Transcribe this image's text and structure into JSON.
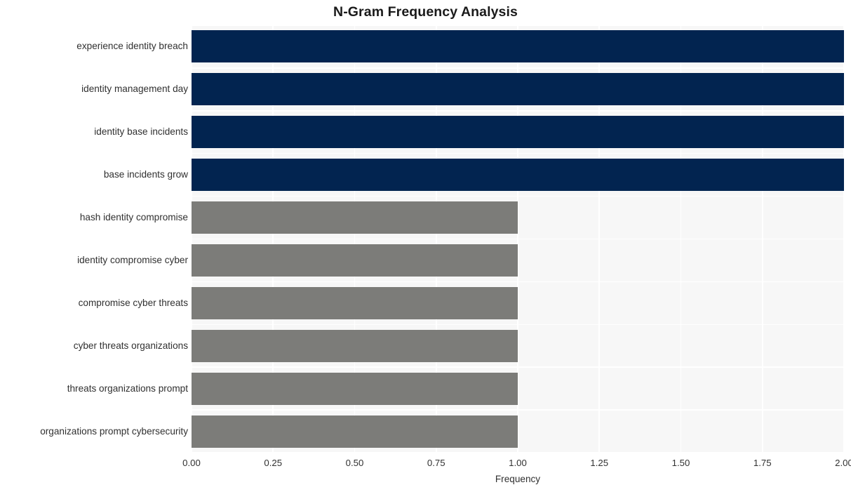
{
  "chart_data": {
    "type": "bar",
    "orientation": "horizontal",
    "title": "N-Gram Frequency Analysis",
    "xlabel": "Frequency",
    "ylabel": "",
    "xlim": [
      0,
      2
    ],
    "ylim": null,
    "grid": true,
    "legend": null,
    "xticklabels": [
      "0.00",
      "0.25",
      "0.50",
      "0.75",
      "1.00",
      "1.25",
      "1.50",
      "1.75",
      "2.00"
    ],
    "xticks": [
      0,
      0.25,
      0.5,
      0.75,
      1.0,
      1.25,
      1.5,
      1.75,
      2.0
    ],
    "categories": [
      "experience identity breach",
      "identity management day",
      "identity base incidents",
      "base incidents grow",
      "hash identity compromise",
      "identity compromise cyber",
      "compromise cyber threats",
      "cyber threats organizations",
      "threats organizations prompt",
      "organizations prompt cybersecurity"
    ],
    "values": [
      2,
      2,
      2,
      2,
      1,
      1,
      1,
      1,
      1,
      1
    ],
    "bar_colors": [
      "#022450",
      "#022450",
      "#022450",
      "#022450",
      "#7c7c79",
      "#7c7c79",
      "#7c7c79",
      "#7c7c79",
      "#7c7c79",
      "#7c7c79"
    ]
  },
  "style": {
    "figure_background": "#ffffff",
    "plot_background": "#f7f7f7",
    "grid_color": "#ffffff",
    "title_color": "#1a1a1a",
    "tick_color": "#303030",
    "accent_high": "#022450",
    "accent_low": "#7c7c79"
  }
}
